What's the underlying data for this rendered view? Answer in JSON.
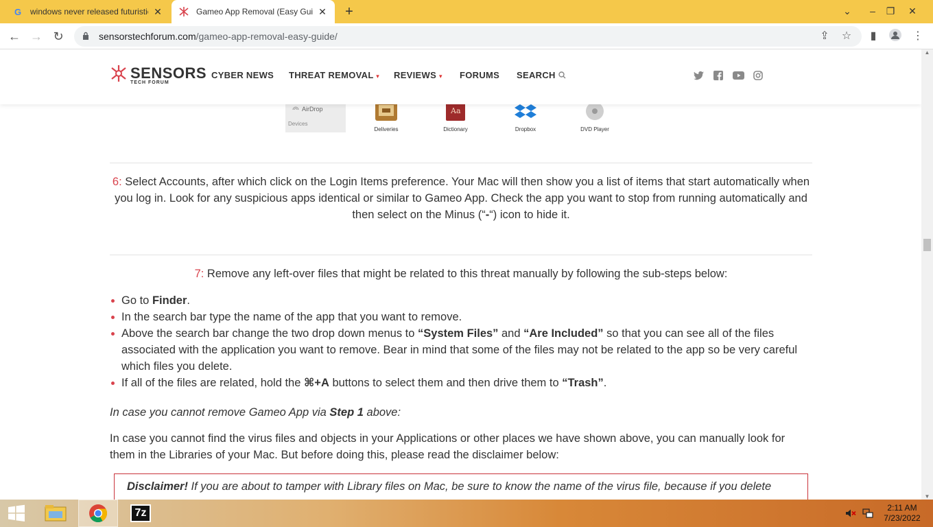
{
  "browser": {
    "tabs": [
      {
        "title": "windows never released futuristic",
        "favicon": "G"
      },
      {
        "title": "Gameo App Removal (Easy Guide)",
        "favicon": "sensors-logo"
      }
    ],
    "new_tab_label": "+",
    "url_domain": "sensorstechforum.com",
    "url_path": "/gameo-app-removal-easy-guide/"
  },
  "site": {
    "logo_word": "SENSORS",
    "logo_sub": "TECH FORUM",
    "nav": [
      {
        "label": "CYBER NEWS"
      },
      {
        "label": "THREAT REMOVAL"
      },
      {
        "label": "REVIEWS"
      },
      {
        "label": "FORUMS"
      },
      {
        "label": "SEARCH"
      }
    ],
    "brand_color": "#d9434d"
  },
  "mac_strip": {
    "sidebar_item": "AirDrop",
    "sidebar_section": "Devices",
    "apps": [
      "Deliveries",
      "Dictionary",
      "Dropbox",
      "DVD Player"
    ]
  },
  "step6": {
    "num": "6:",
    "text": " Select Accounts, after which click on the Login Items preference. Your Mac will then show you a list of items that start automatically when you log in. Look for any suspicious apps identical or similar to Gameo App. Check the app you want to stop from running automatically and then select on the Minus (“",
    "minus": "-",
    "text_end": "“) icon to hide it."
  },
  "step7": {
    "num": "7:",
    "text": " Remove any left-over files that might be related to this threat manually by following the sub-steps below:"
  },
  "bullets": {
    "b1_pre": "Go to ",
    "b1_bold": "Finder",
    "b1_post": ".",
    "b2": "In the search bar type the name of the app that you want to remove.",
    "b3_pre": "Above the search bar change the two drop down menus to ",
    "b3_bold1": "“System Files”",
    "b3_mid": " and ",
    "b3_bold2": "“Are Included”",
    "b3_post": " so that you can see all of the files associated with the application you want to remove. Bear in mind that some of the files may not be related to the app so be very careful which files you delete.",
    "b4_pre": "If all of the files are related, hold the ",
    "b4_bold": "⌘+A",
    "b4_mid": " buttons to select them and then drive them to ",
    "b4_bold2": "“Trash”",
    "b4_post": "."
  },
  "fallback": {
    "pre": "In case you cannot remove Gameo App via ",
    "bold": "Step 1",
    "post": " above:"
  },
  "libraries_para": "In case you cannot find the virus files and objects in your Applications or other places we have shown above, you can manually look for them in the Libraries of your Mac. But before doing this, please read the disclaimer below:",
  "disclaimer": {
    "bold": "Disclaimer!",
    "text": " If you are about to tamper with Library files on Mac, be sure to know the name of the virus file, because if you delete"
  },
  "taskbar": {
    "time": "2:11 AM",
    "date": "7/23/2022",
    "apps": [
      "start",
      "file-explorer",
      "chrome",
      "7zip"
    ],
    "sevenzip_label": "7z"
  }
}
